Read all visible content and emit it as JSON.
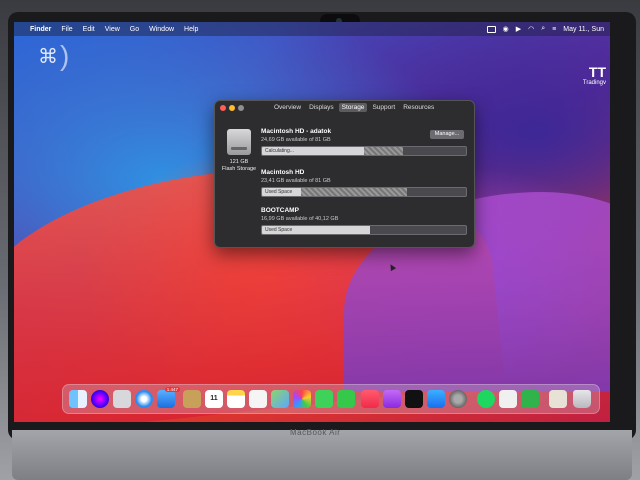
{
  "menubar": {
    "apple": "",
    "items": [
      "Finder",
      "File",
      "Edit",
      "View",
      "Go",
      "Window",
      "Help"
    ],
    "clock": "May 11., Sun"
  },
  "widgets": {
    "trading_big": "TT",
    "trading_small": "Tradingv"
  },
  "about_window": {
    "tabs": [
      "Overview",
      "Displays",
      "Storage",
      "Support",
      "Resources"
    ],
    "active_tab": "Storage",
    "disk_size": "121 GB",
    "disk_type": "Flash Storage",
    "manage_label": "Manage...",
    "volumes": [
      {
        "title": "Macintosh HD - adatok",
        "sub": "24,69 GB available of 81 GB",
        "bar_label": "Calculating...",
        "used_fraction": 0.5,
        "other_fraction": 0.19
      },
      {
        "title": "Macintosh HD",
        "sub": "23,41 GB available of 81 GB",
        "bar_label": "Used Space",
        "used_fraction": 0.19,
        "other_fraction": 0.52
      },
      {
        "title": "BOOTCAMP",
        "sub": "16,99 GB available of 40,12 GB",
        "bar_label": "Used Space",
        "used_fraction": 0.53,
        "other_fraction": 0.0
      }
    ]
  },
  "dock": {
    "mail_badge": "1.447",
    "calendar_day": "11"
  },
  "bezel": {
    "model": "MacBook Air"
  },
  "colors": {
    "window_bg": "#2d2d30",
    "close": "#ff5f57",
    "minimize": "#febc2e",
    "zoom": "#8e8e93"
  }
}
